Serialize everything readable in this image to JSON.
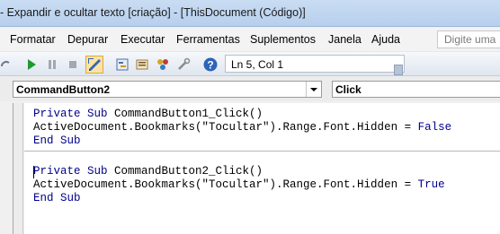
{
  "window": {
    "title": "- Expandir e ocultar texto [criação] - [ThisDocument (Código)]"
  },
  "menu": {
    "items": [
      "Formatar",
      "Depurar",
      "Executar",
      "Ferramentas",
      "Suplementos",
      "Janela",
      "Ajuda"
    ],
    "ask_placeholder": "Digite uma"
  },
  "toolbar": {
    "position": "Ln 5, Col 1",
    "icons": [
      "run-icon",
      "pause-icon",
      "stop-icon",
      "design-mode-icon",
      "project-explorer-icon",
      "properties-icon",
      "object-browser-icon",
      "toolbox-icon",
      "help-icon"
    ]
  },
  "combos": {
    "object": "CommandButton2",
    "procedure": "Click"
  },
  "code": {
    "lines": [
      {
        "kw1": "Private Sub",
        "rest": " CommandButton1_Click()"
      },
      {
        "text": "ActiveDocument.Bookmarks(\"Tocultar\").Range.Font.Hidden = ",
        "kw": "False"
      },
      {
        "kw1": "End Sub",
        "rest": ""
      },
      {
        "kw1": "Private Sub",
        "rest": " CommandButton2_Click()"
      },
      {
        "text": "ActiveDocument.Bookmarks(\"Tocultar\").Range.Font.Hidden = ",
        "kw": "True"
      },
      {
        "kw1": "End Sub",
        "rest": ""
      }
    ]
  },
  "colors": {
    "keyword": "#00008b",
    "titlebar": "#c9dcf2"
  }
}
